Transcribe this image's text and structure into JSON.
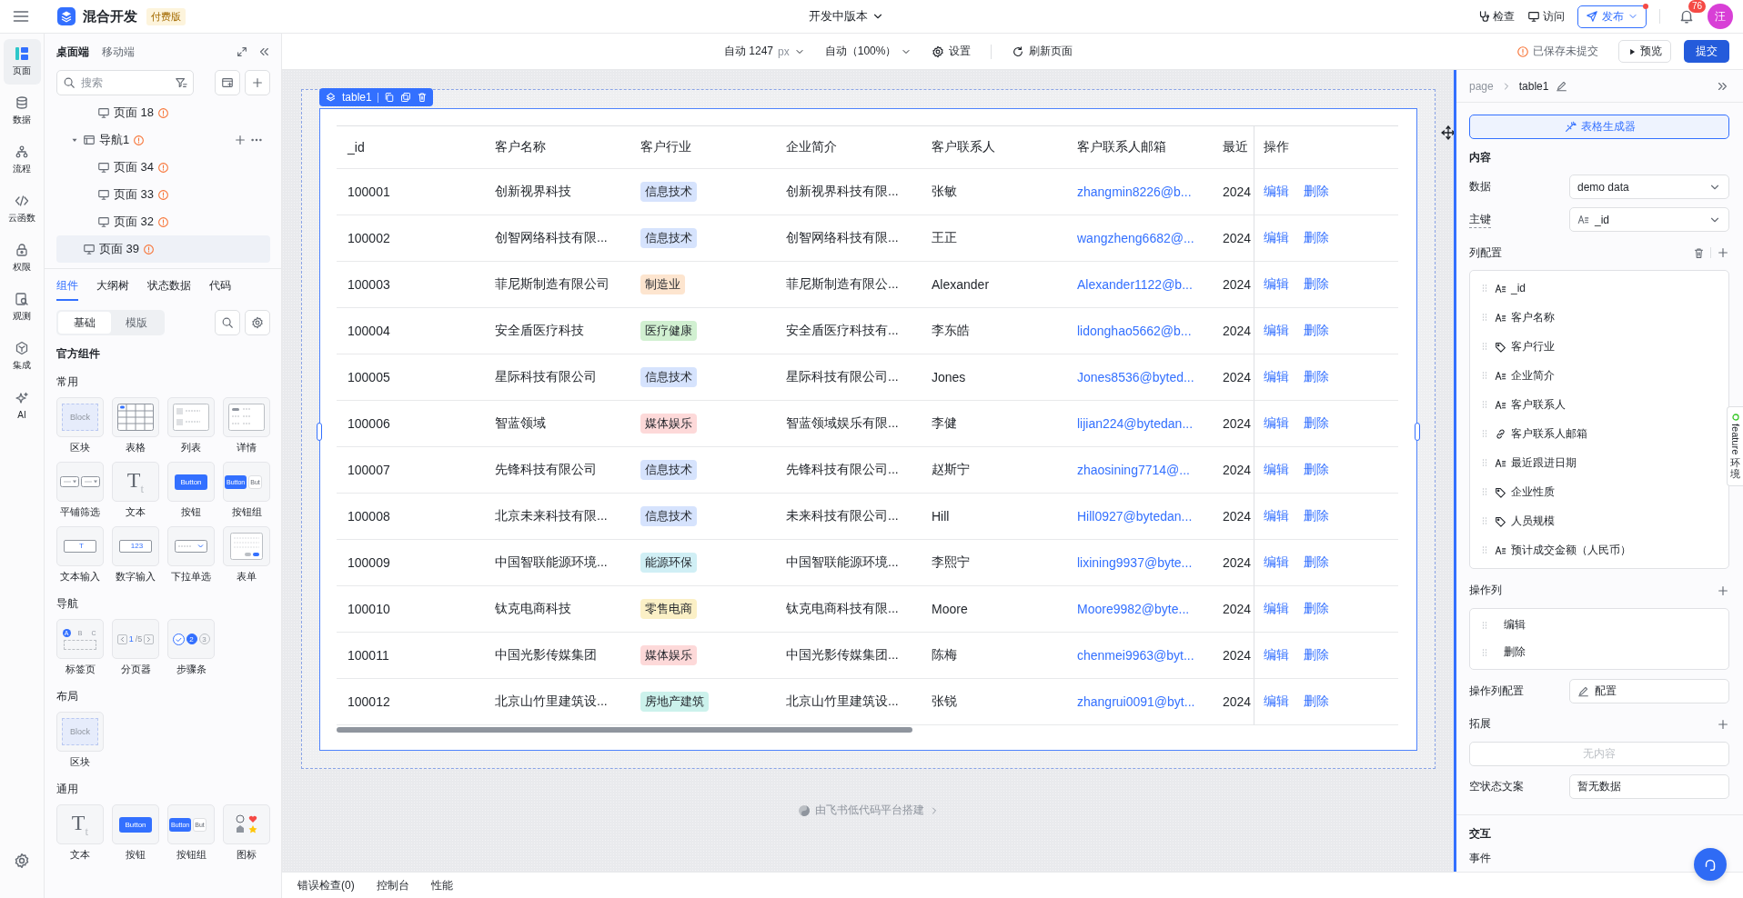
{
  "topbar": {
    "app_name": "混合开发",
    "plan_badge": "付费版",
    "version": "开发中版本",
    "actions": [
      {
        "label": "检查",
        "kind": "inspect"
      },
      {
        "label": "访问",
        "kind": "visit"
      }
    ],
    "publish": {
      "label": "发布",
      "dot": true
    },
    "notifications": "76",
    "avatar": "汪"
  },
  "rail": [
    {
      "label": "页面",
      "kind": "page",
      "selected": true
    },
    {
      "label": "数据",
      "kind": "data",
      "selected": false
    },
    {
      "label": "流程",
      "kind": "flow",
      "selected": false
    },
    {
      "label": "云函数",
      "kind": "code",
      "selected": false
    },
    {
      "label": "权限",
      "kind": "lock",
      "selected": false
    },
    {
      "label": "观测",
      "kind": "observe",
      "selected": false
    },
    {
      "label": "集成",
      "kind": "integrate",
      "selected": false
    },
    {
      "label": "AI",
      "kind": "ai",
      "selected": false
    }
  ],
  "left_panel": {
    "tabs": [
      {
        "label": "桌面端",
        "selected": true
      },
      {
        "label": "移动端",
        "selected": false
      }
    ],
    "search": {
      "placeholder": "搜索"
    },
    "tree": [
      {
        "kind": "continued",
        "children": [
          {
            "label": "页面 18",
            "kind": "page",
            "warning": true,
            "selected": false
          }
        ]
      },
      {
        "label": "导航1",
        "kind": "nav",
        "warning": true,
        "selected": false,
        "expanded": true,
        "children": [
          {
            "label": "页面 34",
            "kind": "page",
            "warning": true,
            "selected": false
          },
          {
            "label": "页面 33",
            "kind": "page",
            "warning": true,
            "selected": false
          },
          {
            "label": "页面 32",
            "kind": "page",
            "warning": true,
            "selected": false
          }
        ]
      },
      {
        "label": "页面 39",
        "kind": "page",
        "warning": true,
        "selected": true
      }
    ],
    "bottom_tabs": [
      {
        "label": "组件",
        "selected": true
      },
      {
        "label": "大纲树",
        "selected": false
      },
      {
        "label": "状态数据",
        "selected": false
      },
      {
        "label": "代码",
        "selected": false
      }
    ],
    "segments": [
      {
        "label": "基础",
        "selected": true
      },
      {
        "label": "模版",
        "selected": false
      }
    ],
    "heading": "官方组件",
    "groups": [
      {
        "title": "常用",
        "items": [
          {
            "label": "区块",
            "kind": "block",
            "texts": [
              "Block"
            ]
          },
          {
            "label": "表格",
            "kind": "table"
          },
          {
            "label": "列表",
            "kind": "list"
          },
          {
            "label": "详情",
            "kind": "detail"
          },
          {
            "label": "平铺筛选",
            "kind": "filter"
          },
          {
            "label": "文本",
            "kind": "text",
            "texts": [
              "T$_{t}$"
            ]
          },
          {
            "label": "按钮",
            "kind": "button",
            "texts": [
              "Button"
            ]
          },
          {
            "label": "按钮组",
            "kind": "buttons",
            "texts": [
              "Button",
              "But"
            ]
          },
          {
            "label": "文本输入",
            "kind": "input",
            "texts": [
              "T"
            ]
          },
          {
            "label": "数字输入",
            "kind": "input",
            "texts": [
              "123"
            ]
          },
          {
            "label": "下拉单选",
            "kind": "select"
          },
          {
            "label": "表单",
            "kind": "form"
          }
        ]
      },
      {
        "title": "导航",
        "items": [
          {
            "label": "标签页",
            "kind": "tabs",
            "texts": [
              "A",
              "B",
              "C"
            ]
          },
          {
            "label": "分页器",
            "kind": "pager",
            "texts": [
              "1",
              "/5"
            ]
          },
          {
            "label": "步骤条",
            "kind": "steps",
            "texts": [
              "2",
              "3"
            ]
          }
        ]
      },
      {
        "title": "布局",
        "items": [
          {
            "label": "区块",
            "kind": "block",
            "texts": [
              "Block"
            ]
          }
        ]
      },
      {
        "title": "通用",
        "items": [
          {
            "label": "文本",
            "kind": "text",
            "texts": [
              "T$_{t}$"
            ]
          },
          {
            "label": "按钮",
            "kind": "button",
            "texts": [
              "Button"
            ]
          },
          {
            "label": "按钮组",
            "kind": "buttons",
            "texts": [
              "Button",
              "But"
            ]
          },
          {
            "label": "图标",
            "kind": "icons"
          }
        ]
      }
    ]
  },
  "toolbar": {
    "width": {
      "mode": "自动",
      "value": "1247",
      "unit": "px"
    },
    "zoom": "自动（100%）",
    "settings": "设置",
    "refresh": "刷新页面",
    "save_status": "已保存未提交",
    "preview": "预览",
    "submit": "提交"
  },
  "canvas": {
    "component": "table1",
    "table": {
      "columns": [
        {
          "label": "_id",
          "kind": "text"
        },
        {
          "label": "客户名称",
          "kind": "text"
        },
        {
          "label": "客户行业",
          "kind": "tag"
        },
        {
          "label": "企业简介",
          "kind": "text"
        },
        {
          "label": "客户联系人",
          "kind": "text"
        },
        {
          "label": "客户联系人邮箱",
          "kind": "link"
        },
        {
          "label": "最近",
          "kind": "text"
        },
        {
          "label": "操作",
          "kind": "actions"
        }
      ],
      "rows": [
        {
          "cells": [
            "100001",
            "创新视界科技",
            {
              "text": "信息技术",
              "color": "#d6e3fd"
            },
            "创新视界科技有限...",
            "张敏",
            "zhangmin8226@b...",
            "2024",
            [
              "编辑",
              "删除"
            ]
          ]
        },
        {
          "cells": [
            "100002",
            "创智网络科技有限...",
            {
              "text": "信息技术",
              "color": "#d6e3fd"
            },
            "创智网络科技有限...",
            "王正",
            "wangzheng6682@...",
            "2024",
            [
              "编辑",
              "删除"
            ]
          ]
        },
        {
          "cells": [
            "100003",
            "菲尼斯制造有限公司",
            {
              "text": "制造业",
              "color": "#fde5cf"
            },
            "菲尼斯制造有限公...",
            "Alexander",
            "Alexander1122@b...",
            "2024",
            [
              "编辑",
              "删除"
            ]
          ]
        },
        {
          "cells": [
            "100004",
            "安全盾医疗科技",
            {
              "text": "医疗健康",
              "color": "#d1f0d1"
            },
            "安全盾医疗科技有...",
            "李东皓",
            "lidonghao5662@b...",
            "2024",
            [
              "编辑",
              "删除"
            ]
          ]
        },
        {
          "cells": [
            "100005",
            "星际科技有限公司",
            {
              "text": "信息技术",
              "color": "#d6e3fd"
            },
            "星际科技有限公司...",
            "Jones",
            "Jones8536@byted...",
            "2024",
            [
              "编辑",
              "删除"
            ]
          ]
        },
        {
          "cells": [
            "100006",
            "智蓝领域",
            {
              "text": "媒体娱乐",
              "color": "#fdd9d9"
            },
            "智蓝领域娱乐有限...",
            "李健",
            "lijian224@bytedan...",
            "2024",
            [
              "编辑",
              "删除"
            ]
          ]
        },
        {
          "cells": [
            "100007",
            "先锋科技有限公司",
            {
              "text": "信息技术",
              "color": "#d6e3fd"
            },
            "先锋科技有限公司...",
            "赵斯宁",
            "zhaosining7714@...",
            "2024",
            [
              "编辑",
              "删除"
            ]
          ]
        },
        {
          "cells": [
            "100008",
            "北京未来科技有限...",
            {
              "text": "信息技术",
              "color": "#d6e3fd"
            },
            "未来科技有限公司...",
            "Hill",
            "Hill0927@bytedan...",
            "2024",
            [
              "编辑",
              "删除"
            ]
          ]
        },
        {
          "cells": [
            "100009",
            "中国智联能源环境...",
            {
              "text": "能源环保",
              "color": "#d0eff5"
            },
            "中国智联能源环境...",
            "李熙宁",
            "lixining9937@byte...",
            "2024",
            [
              "编辑",
              "删除"
            ]
          ]
        },
        {
          "cells": [
            "100010",
            "钛克电商科技",
            {
              "text": "零售电商",
              "color": "#fbf0c6"
            },
            "钛克电商科技有限...",
            "Moore",
            "Moore9982@byte...",
            "2024",
            [
              "编辑",
              "删除"
            ]
          ]
        },
        {
          "cells": [
            "100011",
            "中国光影传媒集团",
            {
              "text": "媒体娱乐",
              "color": "#fdd9d9"
            },
            "中国光影传媒集团...",
            "陈梅",
            "chenmei9963@byt...",
            "2024",
            [
              "编辑",
              "删除"
            ]
          ]
        },
        {
          "cells": [
            "100012",
            "北京山竹里建筑设...",
            {
              "text": "房地产建筑",
              "color": "#ccf2ec"
            },
            "北京山竹里建筑设...",
            "张锐",
            "zhangrui0091@byt...",
            "2024",
            [
              "编辑",
              "删除"
            ]
          ]
        }
      ]
    },
    "footer": "由飞书低代码平台搭建"
  },
  "inspector": {
    "breadcrumb": {
      "parent": "page",
      "current": "table1"
    },
    "generator": "表格生成器",
    "section": "内容",
    "fields": [
      {
        "label": "数据",
        "value": "demo data",
        "hint": false
      },
      {
        "label": "主键",
        "value": "_id",
        "kind": "text",
        "hint": true
      }
    ],
    "columns_title": "列配置",
    "columns": [
      {
        "label": "_id",
        "kind": "text"
      },
      {
        "label": "客户名称",
        "kind": "text"
      },
      {
        "label": "客户行业",
        "kind": "tag"
      },
      {
        "label": "企业简介",
        "kind": "text"
      },
      {
        "label": "客户联系人",
        "kind": "text"
      },
      {
        "label": "客户联系人邮箱",
        "kind": "link"
      },
      {
        "label": "最近跟进日期",
        "kind": "text"
      },
      {
        "label": "企业性质",
        "kind": "tag"
      },
      {
        "label": "人员规模",
        "kind": "tag"
      },
      {
        "label": "预计成交金额（人民币）",
        "kind": "text"
      }
    ],
    "actions_title": "操作列",
    "actions": [
      "编辑",
      "删除"
    ],
    "action_config": {
      "label": "操作列配置",
      "button": "配置"
    },
    "extension": {
      "title": "拓展",
      "empty": "无内容"
    },
    "empty_text": {
      "label": "空状态文案",
      "value": "暂无数据"
    },
    "interaction": "交互",
    "events": "事件"
  },
  "feature_tab": {
    "label": "feature",
    "env": "环境"
  },
  "bottom_bar": {
    "tabs": [
      "错误检查(0)",
      "控制台",
      "性能"
    ]
  }
}
